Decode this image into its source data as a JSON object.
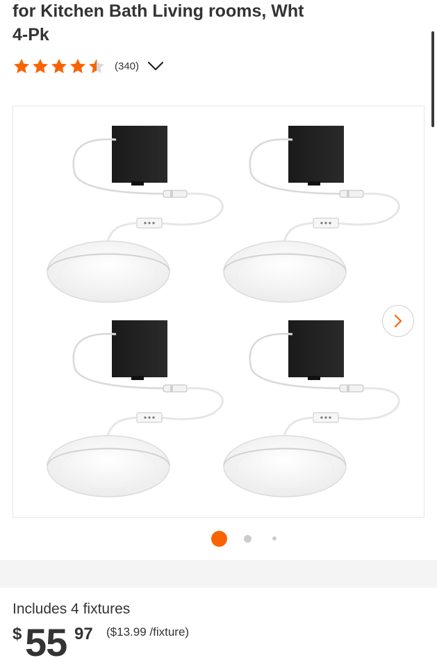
{
  "product": {
    "title_lines": [
      "for Kitchen Bath Living rooms, Wht",
      "4-Pk"
    ],
    "rating": 4.5,
    "rating_max": 5,
    "review_count": "(340)"
  },
  "gallery": {
    "image_count": 3,
    "active_index": 0
  },
  "pricing": {
    "includes": "Includes 4 fixtures",
    "currency": "$",
    "whole": "55",
    "cents": "97",
    "unit_price": "($13.99 /fixture)"
  },
  "colors": {
    "brand_orange": "#f96302",
    "star_empty": "#d9d9d9",
    "text": "#333333"
  },
  "icons": {
    "rating_toggle": "chevron-down-icon",
    "gallery_next": "chevron-right-icon"
  }
}
